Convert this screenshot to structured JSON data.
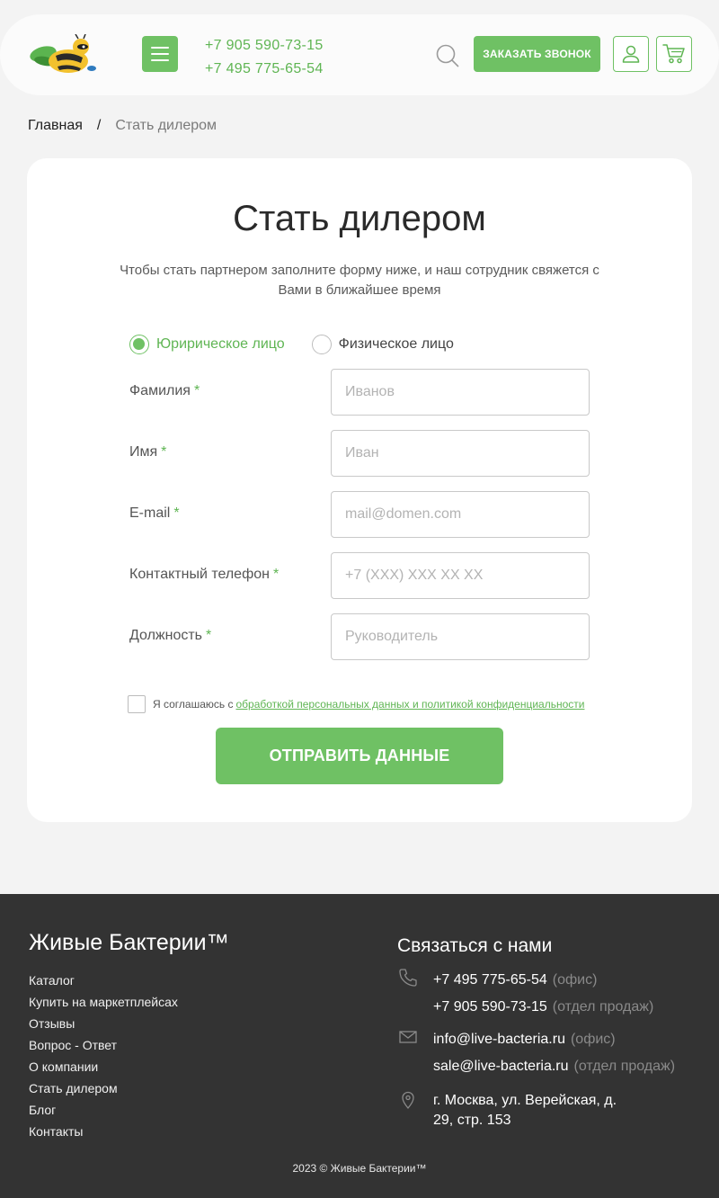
{
  "header": {
    "phones": [
      "+7 905 590-73-15",
      "+7 495 775-65-54"
    ],
    "call_button": "ЗАКАЗАТЬ ЗВОНОК",
    "icons": {
      "logo": "bee-logo-icon",
      "menu": "menu-icon",
      "search": "search-icon",
      "user": "user-icon",
      "cart": "cart-icon"
    }
  },
  "breadcrumb": {
    "home": "Главная",
    "separator": "/",
    "current": "Стать дилером"
  },
  "form": {
    "title": "Стать дилером",
    "subtitle": "Чтобы стать партнером заполните форму ниже, и наш сотрудник свяжется с Вами в ближайшее время",
    "radio": {
      "option1": "Юририческое лицо",
      "option2": "Физическое лицо",
      "selected": "option1"
    },
    "required_mark": "*",
    "fields": [
      {
        "label": "Фамилия",
        "placeholder": "Иванов"
      },
      {
        "label": "Имя",
        "placeholder": "Иван"
      },
      {
        "label": "E-mail",
        "placeholder": "mail@domen.com"
      },
      {
        "label": "Контактный телефон",
        "placeholder": "+7 (XXX) XXX XX XX"
      },
      {
        "label": "Должность",
        "placeholder": "Руководитель"
      }
    ],
    "consent_text": "Я соглашаюсь с",
    "consent_link": "обработкой персональных данных и политикой конфиденциальности",
    "submit": "ОТПРАВИТЬ ДАННЫЕ"
  },
  "footer": {
    "brand": "Живые Бактерии™",
    "nav": [
      "Каталог",
      "Купить на маркетплейсах",
      "Отзывы",
      "Вопрос - Ответ",
      "О компании",
      "Стать дилером",
      "Блог",
      "Контакты"
    ],
    "contact_title": "Связаться с нами",
    "phones": [
      {
        "value": "+7 495 775-65-54",
        "note": "(офис)"
      },
      {
        "value": "+7 905 590-73-15",
        "note": "(отдел продаж)"
      }
    ],
    "emails": [
      {
        "value": "info@live-bacteria.ru",
        "note": "(офис)"
      },
      {
        "value": "sale@live-bacteria.ru",
        "note": "(отдел продаж)"
      }
    ],
    "address": "г. Москва, ул. Верейская, д. 29, стр. 153",
    "copyright": "2023 © Живые Бактерии™"
  },
  "colors": {
    "accent": "#6fc164",
    "footer_bg": "#333333",
    "page_bg": "#f3f3f3"
  }
}
